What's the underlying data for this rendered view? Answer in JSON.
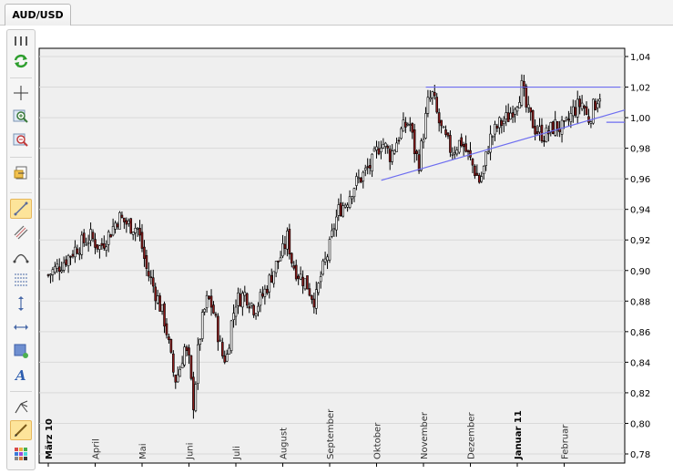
{
  "tab": {
    "label": "AUD/USD"
  },
  "toolbar": {
    "items": [
      {
        "name": "menu-grip-icon"
      },
      {
        "name": "refresh-icon"
      },
      {
        "name": "crosshair-icon"
      },
      {
        "name": "zoom-in-icon"
      },
      {
        "name": "zoom-out-icon"
      },
      {
        "name": "export-icon"
      },
      {
        "name": "trend-line-icon",
        "active": true
      },
      {
        "name": "channel-icon"
      },
      {
        "name": "arc-icon"
      },
      {
        "name": "fibonacci-icon"
      },
      {
        "name": "vertical-line-icon"
      },
      {
        "name": "horizontal-line-icon"
      },
      {
        "name": "rectangle-icon"
      },
      {
        "name": "text-tool-icon"
      },
      {
        "name": "pitchfork-icon"
      },
      {
        "name": "pen-icon",
        "active": true
      },
      {
        "name": "palette-icon"
      }
    ]
  },
  "chart_data": {
    "type": "candlestick",
    "symbol": "AUD/USD",
    "y_ticks": [
      "1,04",
      "1,02",
      "1,00",
      "0,98",
      "0,96",
      "0,94",
      "0,92",
      "0,90",
      "0,88",
      "0,86",
      "0,84",
      "0,82",
      "0,80",
      "0,78"
    ],
    "ylim": [
      0.78,
      1.04
    ],
    "x_labels": [
      {
        "label": "März 10",
        "bold": true,
        "month": 0
      },
      {
        "label": "April",
        "bold": false,
        "month": 1
      },
      {
        "label": "Mai",
        "bold": false,
        "month": 2
      },
      {
        "label": "Juni",
        "bold": false,
        "month": 3
      },
      {
        "label": "Juli",
        "bold": false,
        "month": 4
      },
      {
        "label": "August",
        "bold": false,
        "month": 5
      },
      {
        "label": "September",
        "bold": false,
        "month": 6
      },
      {
        "label": "Oktober",
        "bold": false,
        "month": 7
      },
      {
        "label": "November",
        "bold": false,
        "month": 8
      },
      {
        "label": "Dezember",
        "bold": false,
        "month": 9
      },
      {
        "label": "Januar 11",
        "bold": true,
        "month": 10
      },
      {
        "label": "Februar",
        "bold": false,
        "month": 11
      }
    ],
    "grid": true,
    "up_color": "#ffffff",
    "down_color": "#8b1a1a",
    "wick_color": "#000000",
    "trendline_color": "#6e6ef0",
    "close_path": [
      [
        0,
        0.897
      ],
      [
        0.3,
        0.905
      ],
      [
        0.6,
        0.915
      ],
      [
        0.9,
        0.922
      ],
      [
        1.1,
        0.915
      ],
      [
        1.3,
        0.924
      ],
      [
        1.5,
        0.935
      ],
      [
        1.7,
        0.93
      ],
      [
        1.9,
        0.928
      ],
      [
        2.0,
        0.915
      ],
      [
        2.1,
        0.9
      ],
      [
        2.2,
        0.893
      ],
      [
        2.35,
        0.88
      ],
      [
        2.5,
        0.865
      ],
      [
        2.6,
        0.845
      ],
      [
        2.7,
        0.828
      ],
      [
        2.8,
        0.835
      ],
      [
        2.9,
        0.85
      ],
      [
        3.0,
        0.84
      ],
      [
        3.05,
        0.825
      ],
      [
        3.1,
        0.812
      ],
      [
        3.2,
        0.85
      ],
      [
        3.3,
        0.87
      ],
      [
        3.4,
        0.882
      ],
      [
        3.5,
        0.876
      ],
      [
        3.6,
        0.862
      ],
      [
        3.7,
        0.845
      ],
      [
        3.8,
        0.842
      ],
      [
        3.9,
        0.865
      ],
      [
        4.0,
        0.88
      ],
      [
        4.2,
        0.885
      ],
      [
        4.4,
        0.875
      ],
      [
        4.6,
        0.885
      ],
      [
        4.8,
        0.9
      ],
      [
        5.0,
        0.912
      ],
      [
        5.1,
        0.922
      ],
      [
        5.2,
        0.905
      ],
      [
        5.35,
        0.897
      ],
      [
        5.5,
        0.892
      ],
      [
        5.6,
        0.885
      ],
      [
        5.7,
        0.88
      ],
      [
        5.8,
        0.895
      ],
      [
        5.9,
        0.905
      ],
      [
        6.0,
        0.915
      ],
      [
        6.1,
        0.93
      ],
      [
        6.2,
        0.94
      ],
      [
        6.35,
        0.945
      ],
      [
        6.5,
        0.955
      ],
      [
        6.7,
        0.962
      ],
      [
        6.9,
        0.97
      ],
      [
        7.1,
        0.985
      ],
      [
        7.3,
        0.975
      ],
      [
        7.5,
        0.99
      ],
      [
        7.7,
        0.998
      ],
      [
        7.8,
        0.98
      ],
      [
        7.9,
        0.97
      ],
      [
        8.0,
        0.99
      ],
      [
        8.1,
        1.01
      ],
      [
        8.2,
        1.015
      ],
      [
        8.3,
        1.0
      ],
      [
        8.4,
        0.99
      ],
      [
        8.6,
        0.978
      ],
      [
        8.8,
        0.985
      ],
      [
        9.0,
        0.972
      ],
      [
        9.2,
        0.958
      ],
      [
        9.3,
        0.968
      ],
      [
        9.4,
        0.985
      ],
      [
        9.6,
        0.995
      ],
      [
        9.8,
        1.0
      ],
      [
        10.0,
        1.012
      ],
      [
        10.1,
        1.02
      ],
      [
        10.2,
        1.005
      ],
      [
        10.4,
        0.992
      ],
      [
        10.6,
        0.988
      ],
      [
        10.8,
        0.995
      ],
      [
        11.0,
        0.992
      ],
      [
        11.2,
        1.005
      ],
      [
        11.4,
        1.01
      ],
      [
        11.5,
        0.998
      ],
      [
        11.6,
        1.005
      ],
      [
        11.7,
        1.012
      ],
      [
        11.8,
        1.018
      ]
    ],
    "trendlines": [
      {
        "kind": "resistance",
        "from": [
          8.05,
          1.02
        ],
        "to": [
          12.2,
          1.02
        ]
      },
      {
        "kind": "support",
        "from": [
          7.1,
          0.959
        ],
        "to": [
          12.5,
          1.005
        ]
      },
      {
        "kind": "level",
        "from": [
          11.9,
          0.997
        ],
        "to": [
          12.5,
          0.997
        ]
      }
    ]
  }
}
